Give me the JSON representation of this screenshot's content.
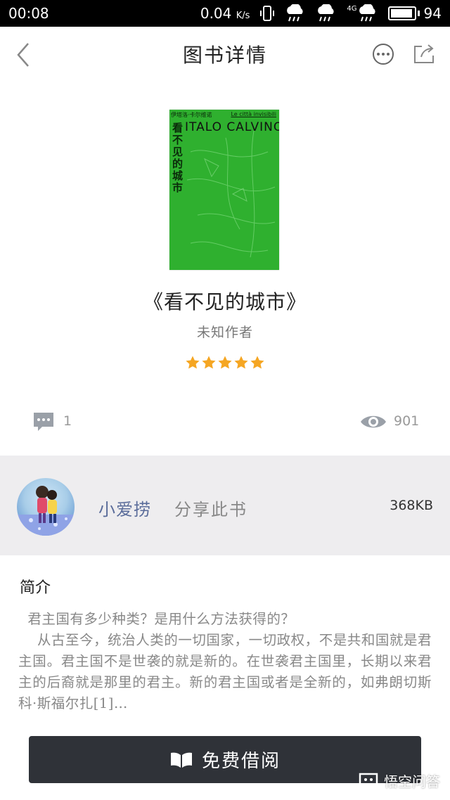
{
  "status_bar": {
    "time": "00:08",
    "net_speed": "0.04",
    "net_unit": "K/s",
    "network": "4G",
    "battery": "94",
    "battery_level": 0.94
  },
  "header": {
    "title": "图书详情"
  },
  "cover": {
    "top_left": "伊塔洛·卡尔维诺",
    "top_right": "Le città invisibili",
    "author_banner": "ITALO CALVINO",
    "title_vertical": "看不见的城市",
    "color": "#2fb02f"
  },
  "book": {
    "title": "《看不见的城市》",
    "author": "未知作者",
    "rating": 5,
    "rating_max": 5,
    "star_color": "#f5a623"
  },
  "stats": {
    "comments": "1",
    "views": "901"
  },
  "share": {
    "user": "小爱捞",
    "action": "分享此书",
    "file_size": "368KB"
  },
  "intro": {
    "heading": "简介",
    "text": "  君主国有多少种类？是用什么方法获得的？\n    从古至今，统治人类的一切国家，一切政权，不是共和国就是君主国。君主国不是世袭的就是新的。在世袭君主国里，长期以来君主的后裔就是那里的君主。新的君主国或者是全新的，如弗朗切斯科·斯福尔扎[1]…"
  },
  "action": {
    "borrow_label": "免费借阅"
  },
  "watermark": {
    "text": "悟空问答"
  }
}
